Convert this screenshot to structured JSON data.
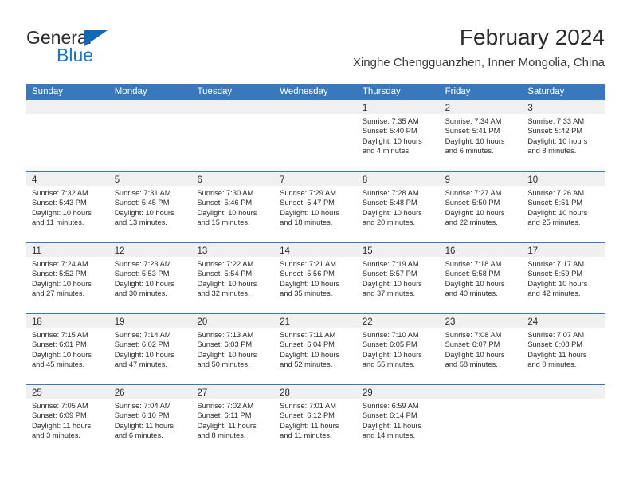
{
  "brand": {
    "name_top": "General",
    "name_bottom": "Blue",
    "color_blue": "#1878c8",
    "triangle_color": "#1268b3"
  },
  "header": {
    "title": "February 2024",
    "subtitle": "Xinghe Chengguanzhen, Inner Mongolia, China"
  },
  "theme": {
    "header_blue": "#3a78bd",
    "band_gray": "#f0f0f0",
    "text": "#2b2b2b"
  },
  "weekdays": [
    "Sunday",
    "Monday",
    "Tuesday",
    "Wednesday",
    "Thursday",
    "Friday",
    "Saturday"
  ],
  "weeks": [
    [
      {
        "day": "",
        "sunrise": "",
        "sunset": "",
        "daylight1": "",
        "daylight2": ""
      },
      {
        "day": "",
        "sunrise": "",
        "sunset": "",
        "daylight1": "",
        "daylight2": ""
      },
      {
        "day": "",
        "sunrise": "",
        "sunset": "",
        "daylight1": "",
        "daylight2": ""
      },
      {
        "day": "",
        "sunrise": "",
        "sunset": "",
        "daylight1": "",
        "daylight2": ""
      },
      {
        "day": "1",
        "sunrise": "Sunrise: 7:35 AM",
        "sunset": "Sunset: 5:40 PM",
        "daylight1": "Daylight: 10 hours",
        "daylight2": "and 4 minutes."
      },
      {
        "day": "2",
        "sunrise": "Sunrise: 7:34 AM",
        "sunset": "Sunset: 5:41 PM",
        "daylight1": "Daylight: 10 hours",
        "daylight2": "and 6 minutes."
      },
      {
        "day": "3",
        "sunrise": "Sunrise: 7:33 AM",
        "sunset": "Sunset: 5:42 PM",
        "daylight1": "Daylight: 10 hours",
        "daylight2": "and 8 minutes."
      }
    ],
    [
      {
        "day": "4",
        "sunrise": "Sunrise: 7:32 AM",
        "sunset": "Sunset: 5:43 PM",
        "daylight1": "Daylight: 10 hours",
        "daylight2": "and 11 minutes."
      },
      {
        "day": "5",
        "sunrise": "Sunrise: 7:31 AM",
        "sunset": "Sunset: 5:45 PM",
        "daylight1": "Daylight: 10 hours",
        "daylight2": "and 13 minutes."
      },
      {
        "day": "6",
        "sunrise": "Sunrise: 7:30 AM",
        "sunset": "Sunset: 5:46 PM",
        "daylight1": "Daylight: 10 hours",
        "daylight2": "and 15 minutes."
      },
      {
        "day": "7",
        "sunrise": "Sunrise: 7:29 AM",
        "sunset": "Sunset: 5:47 PM",
        "daylight1": "Daylight: 10 hours",
        "daylight2": "and 18 minutes."
      },
      {
        "day": "8",
        "sunrise": "Sunrise: 7:28 AM",
        "sunset": "Sunset: 5:48 PM",
        "daylight1": "Daylight: 10 hours",
        "daylight2": "and 20 minutes."
      },
      {
        "day": "9",
        "sunrise": "Sunrise: 7:27 AM",
        "sunset": "Sunset: 5:50 PM",
        "daylight1": "Daylight: 10 hours",
        "daylight2": "and 22 minutes."
      },
      {
        "day": "10",
        "sunrise": "Sunrise: 7:26 AM",
        "sunset": "Sunset: 5:51 PM",
        "daylight1": "Daylight: 10 hours",
        "daylight2": "and 25 minutes."
      }
    ],
    [
      {
        "day": "11",
        "sunrise": "Sunrise: 7:24 AM",
        "sunset": "Sunset: 5:52 PM",
        "daylight1": "Daylight: 10 hours",
        "daylight2": "and 27 minutes."
      },
      {
        "day": "12",
        "sunrise": "Sunrise: 7:23 AM",
        "sunset": "Sunset: 5:53 PM",
        "daylight1": "Daylight: 10 hours",
        "daylight2": "and 30 minutes."
      },
      {
        "day": "13",
        "sunrise": "Sunrise: 7:22 AM",
        "sunset": "Sunset: 5:54 PM",
        "daylight1": "Daylight: 10 hours",
        "daylight2": "and 32 minutes."
      },
      {
        "day": "14",
        "sunrise": "Sunrise: 7:21 AM",
        "sunset": "Sunset: 5:56 PM",
        "daylight1": "Daylight: 10 hours",
        "daylight2": "and 35 minutes."
      },
      {
        "day": "15",
        "sunrise": "Sunrise: 7:19 AM",
        "sunset": "Sunset: 5:57 PM",
        "daylight1": "Daylight: 10 hours",
        "daylight2": "and 37 minutes."
      },
      {
        "day": "16",
        "sunrise": "Sunrise: 7:18 AM",
        "sunset": "Sunset: 5:58 PM",
        "daylight1": "Daylight: 10 hours",
        "daylight2": "and 40 minutes."
      },
      {
        "day": "17",
        "sunrise": "Sunrise: 7:17 AM",
        "sunset": "Sunset: 5:59 PM",
        "daylight1": "Daylight: 10 hours",
        "daylight2": "and 42 minutes."
      }
    ],
    [
      {
        "day": "18",
        "sunrise": "Sunrise: 7:15 AM",
        "sunset": "Sunset: 6:01 PM",
        "daylight1": "Daylight: 10 hours",
        "daylight2": "and 45 minutes."
      },
      {
        "day": "19",
        "sunrise": "Sunrise: 7:14 AM",
        "sunset": "Sunset: 6:02 PM",
        "daylight1": "Daylight: 10 hours",
        "daylight2": "and 47 minutes."
      },
      {
        "day": "20",
        "sunrise": "Sunrise: 7:13 AM",
        "sunset": "Sunset: 6:03 PM",
        "daylight1": "Daylight: 10 hours",
        "daylight2": "and 50 minutes."
      },
      {
        "day": "21",
        "sunrise": "Sunrise: 7:11 AM",
        "sunset": "Sunset: 6:04 PM",
        "daylight1": "Daylight: 10 hours",
        "daylight2": "and 52 minutes."
      },
      {
        "day": "22",
        "sunrise": "Sunrise: 7:10 AM",
        "sunset": "Sunset: 6:05 PM",
        "daylight1": "Daylight: 10 hours",
        "daylight2": "and 55 minutes."
      },
      {
        "day": "23",
        "sunrise": "Sunrise: 7:08 AM",
        "sunset": "Sunset: 6:07 PM",
        "daylight1": "Daylight: 10 hours",
        "daylight2": "and 58 minutes."
      },
      {
        "day": "24",
        "sunrise": "Sunrise: 7:07 AM",
        "sunset": "Sunset: 6:08 PM",
        "daylight1": "Daylight: 11 hours",
        "daylight2": "and 0 minutes."
      }
    ],
    [
      {
        "day": "25",
        "sunrise": "Sunrise: 7:05 AM",
        "sunset": "Sunset: 6:09 PM",
        "daylight1": "Daylight: 11 hours",
        "daylight2": "and 3 minutes."
      },
      {
        "day": "26",
        "sunrise": "Sunrise: 7:04 AM",
        "sunset": "Sunset: 6:10 PM",
        "daylight1": "Daylight: 11 hours",
        "daylight2": "and 6 minutes."
      },
      {
        "day": "27",
        "sunrise": "Sunrise: 7:02 AM",
        "sunset": "Sunset: 6:11 PM",
        "daylight1": "Daylight: 11 hours",
        "daylight2": "and 8 minutes."
      },
      {
        "day": "28",
        "sunrise": "Sunrise: 7:01 AM",
        "sunset": "Sunset: 6:12 PM",
        "daylight1": "Daylight: 11 hours",
        "daylight2": "and 11 minutes."
      },
      {
        "day": "29",
        "sunrise": "Sunrise: 6:59 AM",
        "sunset": "Sunset: 6:14 PM",
        "daylight1": "Daylight: 11 hours",
        "daylight2": "and 14 minutes."
      },
      {
        "day": "",
        "sunrise": "",
        "sunset": "",
        "daylight1": "",
        "daylight2": ""
      },
      {
        "day": "",
        "sunrise": "",
        "sunset": "",
        "daylight1": "",
        "daylight2": ""
      }
    ]
  ]
}
